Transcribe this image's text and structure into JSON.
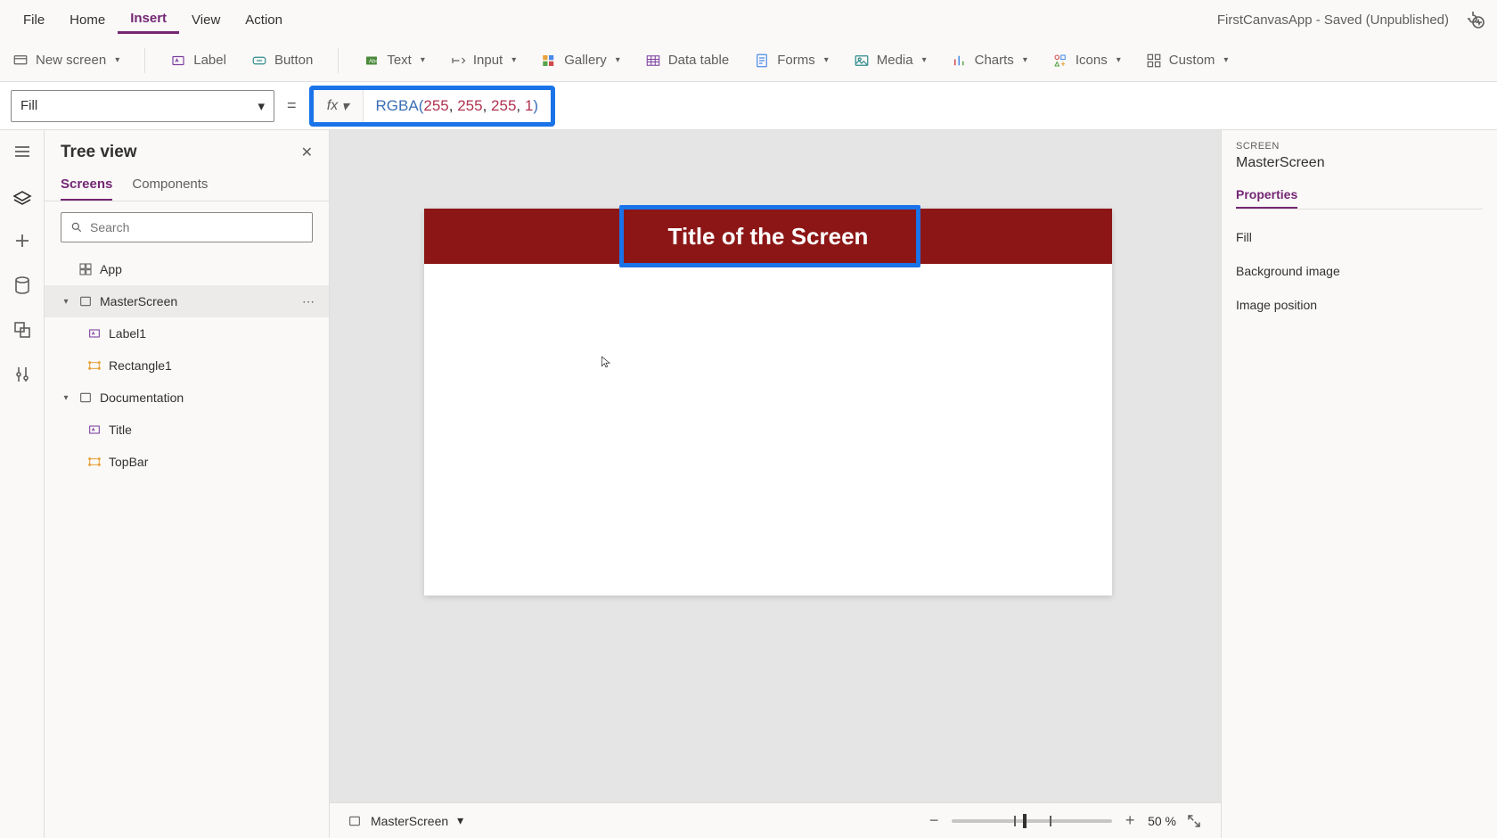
{
  "menubar": {
    "items": [
      "File",
      "Home",
      "Insert",
      "View",
      "Action"
    ],
    "active_index": 2,
    "doc_title": "FirstCanvasApp - Saved (Unpublished)"
  },
  "ribbon": {
    "new_screen": "New screen",
    "label": "Label",
    "button": "Button",
    "text": "Text",
    "input": "Input",
    "gallery": "Gallery",
    "data_table": "Data table",
    "forms": "Forms",
    "media": "Media",
    "charts": "Charts",
    "icons": "Icons",
    "custom": "Custom"
  },
  "formula": {
    "property": "Fill",
    "fx_label": "fx",
    "tokens": {
      "fn": "RGBA",
      "open": "(",
      "n1": "255",
      "n2": "255",
      "n3": "255",
      "n4": "1",
      "comma": ", ",
      "close": ")"
    }
  },
  "tree": {
    "title": "Tree view",
    "tabs": {
      "screens": "Screens",
      "components": "Components"
    },
    "search_placeholder": "Search",
    "nodes": {
      "app": "App",
      "master": "MasterScreen",
      "label1": "Label1",
      "rect1": "Rectangle1",
      "doc": "Documentation",
      "title": "Title",
      "topbar": "TopBar"
    }
  },
  "canvas": {
    "title_text": "Title of the Screen",
    "topbar_color": "#8c1616"
  },
  "status": {
    "screen_name": "MasterScreen",
    "zoom_text": "50  %"
  },
  "props": {
    "kicker": "SCREEN",
    "object": "MasterScreen",
    "tab_properties": "Properties",
    "rows": {
      "fill": "Fill",
      "bg_image": "Background image",
      "img_pos": "Image position"
    }
  }
}
